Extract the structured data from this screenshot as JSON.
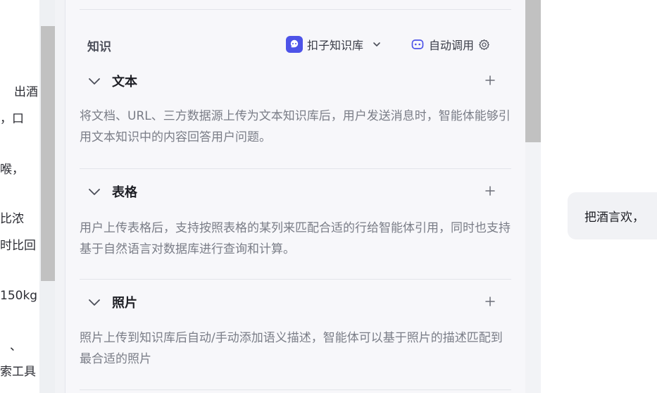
{
  "left_fragments": [
    "出酒",
    "，口",
    "喉，",
    "比浓",
    "时比回",
    "150kg",
    "、",
    "索工具"
  ],
  "knowledge": {
    "title": "知识",
    "kb_selector": {
      "label": "扣子知识库"
    },
    "auto_call": {
      "label": "自动调用"
    },
    "sections": [
      {
        "title": "文本",
        "description": "将文档、URL、三方数据源上传为文本知识库后，用户发送消息时，智能体能够引用文本知识中的内容回答用户问题。"
      },
      {
        "title": "表格",
        "description": "用户上传表格后，支持按照表格的某列来匹配合适的行给智能体引用，同时也支持基于自然语言对数据库进行查询和计算。"
      },
      {
        "title": "照片",
        "description": "照片上传到知识库后自动/手动添加语义描述，智能体可以基于照片的描述匹配到最合适的照片"
      }
    ]
  },
  "chat": {
    "message": "把酒言欢，"
  },
  "colors": {
    "brand": "#4d53e8",
    "panel_bg": "#f7f7fa",
    "scrollbar": "#c1c1c1"
  }
}
